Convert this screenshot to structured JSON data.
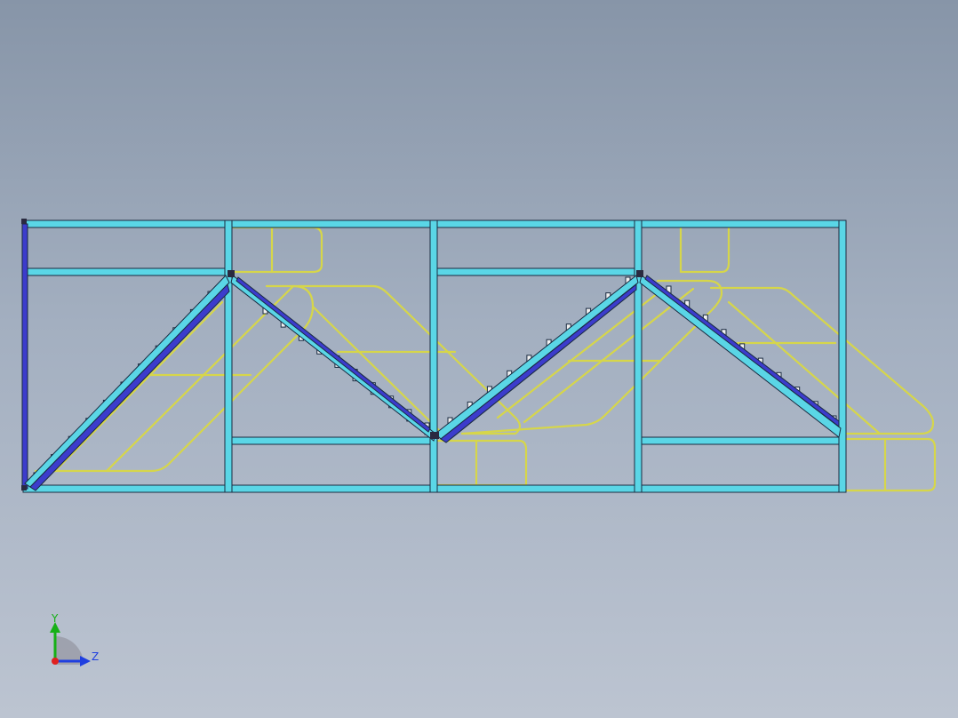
{
  "view": {
    "colors": {
      "frame_fill": "#5ad6e6",
      "frame_edge": "#1a2a40",
      "stringer_fill": "#3c3ccc",
      "rail": "#d6d64a",
      "tread": "#f0f0f0"
    }
  },
  "triad": {
    "y_label": "Y",
    "z_label": "Z",
    "colors": {
      "y_axis": "#16b016",
      "z_axis": "#1f3fe0",
      "origin": "#e02020",
      "label": "#1f3fe0",
      "y_label": "#16b016"
    }
  }
}
